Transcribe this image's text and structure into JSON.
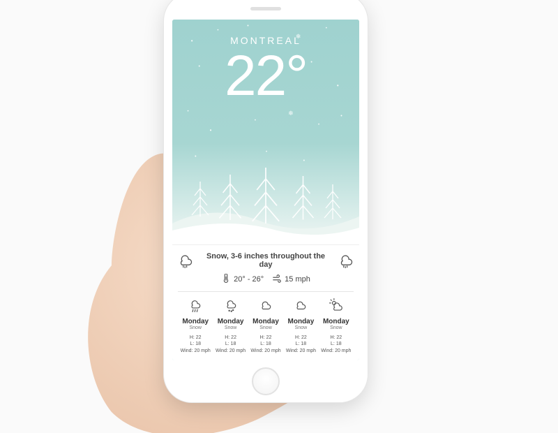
{
  "colors": {
    "bg_sky": "#a1d4d0",
    "text_light": "#ffffff",
    "text_dark": "#444444"
  },
  "hero": {
    "city": "MONTREAL",
    "temperature": "22°"
  },
  "summary": {
    "description": "Snow, 3-6 inches throughout the day",
    "temp_range": "20° - 26°",
    "wind": "15 mph"
  },
  "forecast": [
    {
      "day": "Monday",
      "condition": "Snow",
      "high": "H: 22",
      "low": "L: 18",
      "wind": "Wind: 20 mph",
      "icon": "rain"
    },
    {
      "day": "Monday",
      "condition": "Snow",
      "high": "H: 22",
      "low": "L: 18",
      "wind": "Wind: 20 mph",
      "icon": "drizzle"
    },
    {
      "day": "Monday",
      "condition": "Snow",
      "high": "H: 22",
      "low": "L: 18",
      "wind": "Wind: 20 mph",
      "icon": "cloudy"
    },
    {
      "day": "Monday",
      "condition": "Snow",
      "high": "H: 22",
      "low": "L: 18",
      "wind": "Wind: 20 mph",
      "icon": "cloudy"
    },
    {
      "day": "Monday",
      "condition": "Snow",
      "high": "H: 22",
      "low": "L: 18",
      "wind": "Wind: 20 mph",
      "icon": "partly"
    }
  ]
}
